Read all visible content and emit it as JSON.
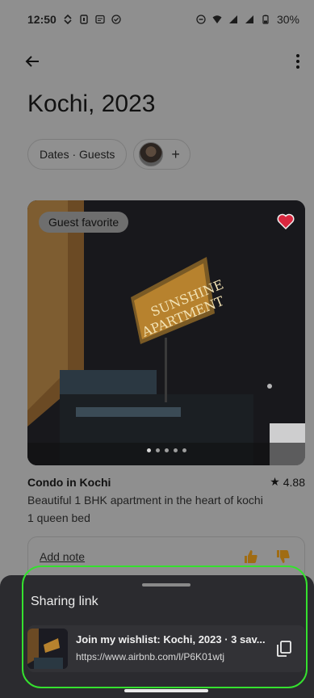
{
  "status_bar": {
    "time": "12:50",
    "battery": "30%"
  },
  "page": {
    "title": "Kochi, 2023"
  },
  "filters": {
    "dates_guests": "Dates · Guests",
    "add_label": "+"
  },
  "listing": {
    "badge": "Guest favorite",
    "name": "Condo in Kochi",
    "rating_star": "★",
    "rating": "4.88",
    "description": "Beautiful 1 BHK apartment in the heart of kochi",
    "beds": "1 queen bed",
    "image_sign_line1": "SUNSHINE",
    "image_sign_line2": "APARTMENT"
  },
  "note": {
    "label": "Add note"
  },
  "sheet": {
    "title": "Sharing link",
    "share_title": "Join my wishlist: Kochi, 2023 · 3 sav...",
    "share_url": "https://www.airbnb.com/l/P6K01wtj"
  },
  "colors": {
    "highlight": "#35e12f",
    "heart": "#d9283f",
    "sheet_bg": "#2b2b2f"
  },
  "icons": {
    "back": "arrow-left-icon",
    "more": "more-vertical-icon",
    "heart": "heart-icon",
    "thumbs_up": "thumbs-up-icon",
    "thumbs_down": "thumbs-down-icon",
    "copy": "copy-icon"
  }
}
